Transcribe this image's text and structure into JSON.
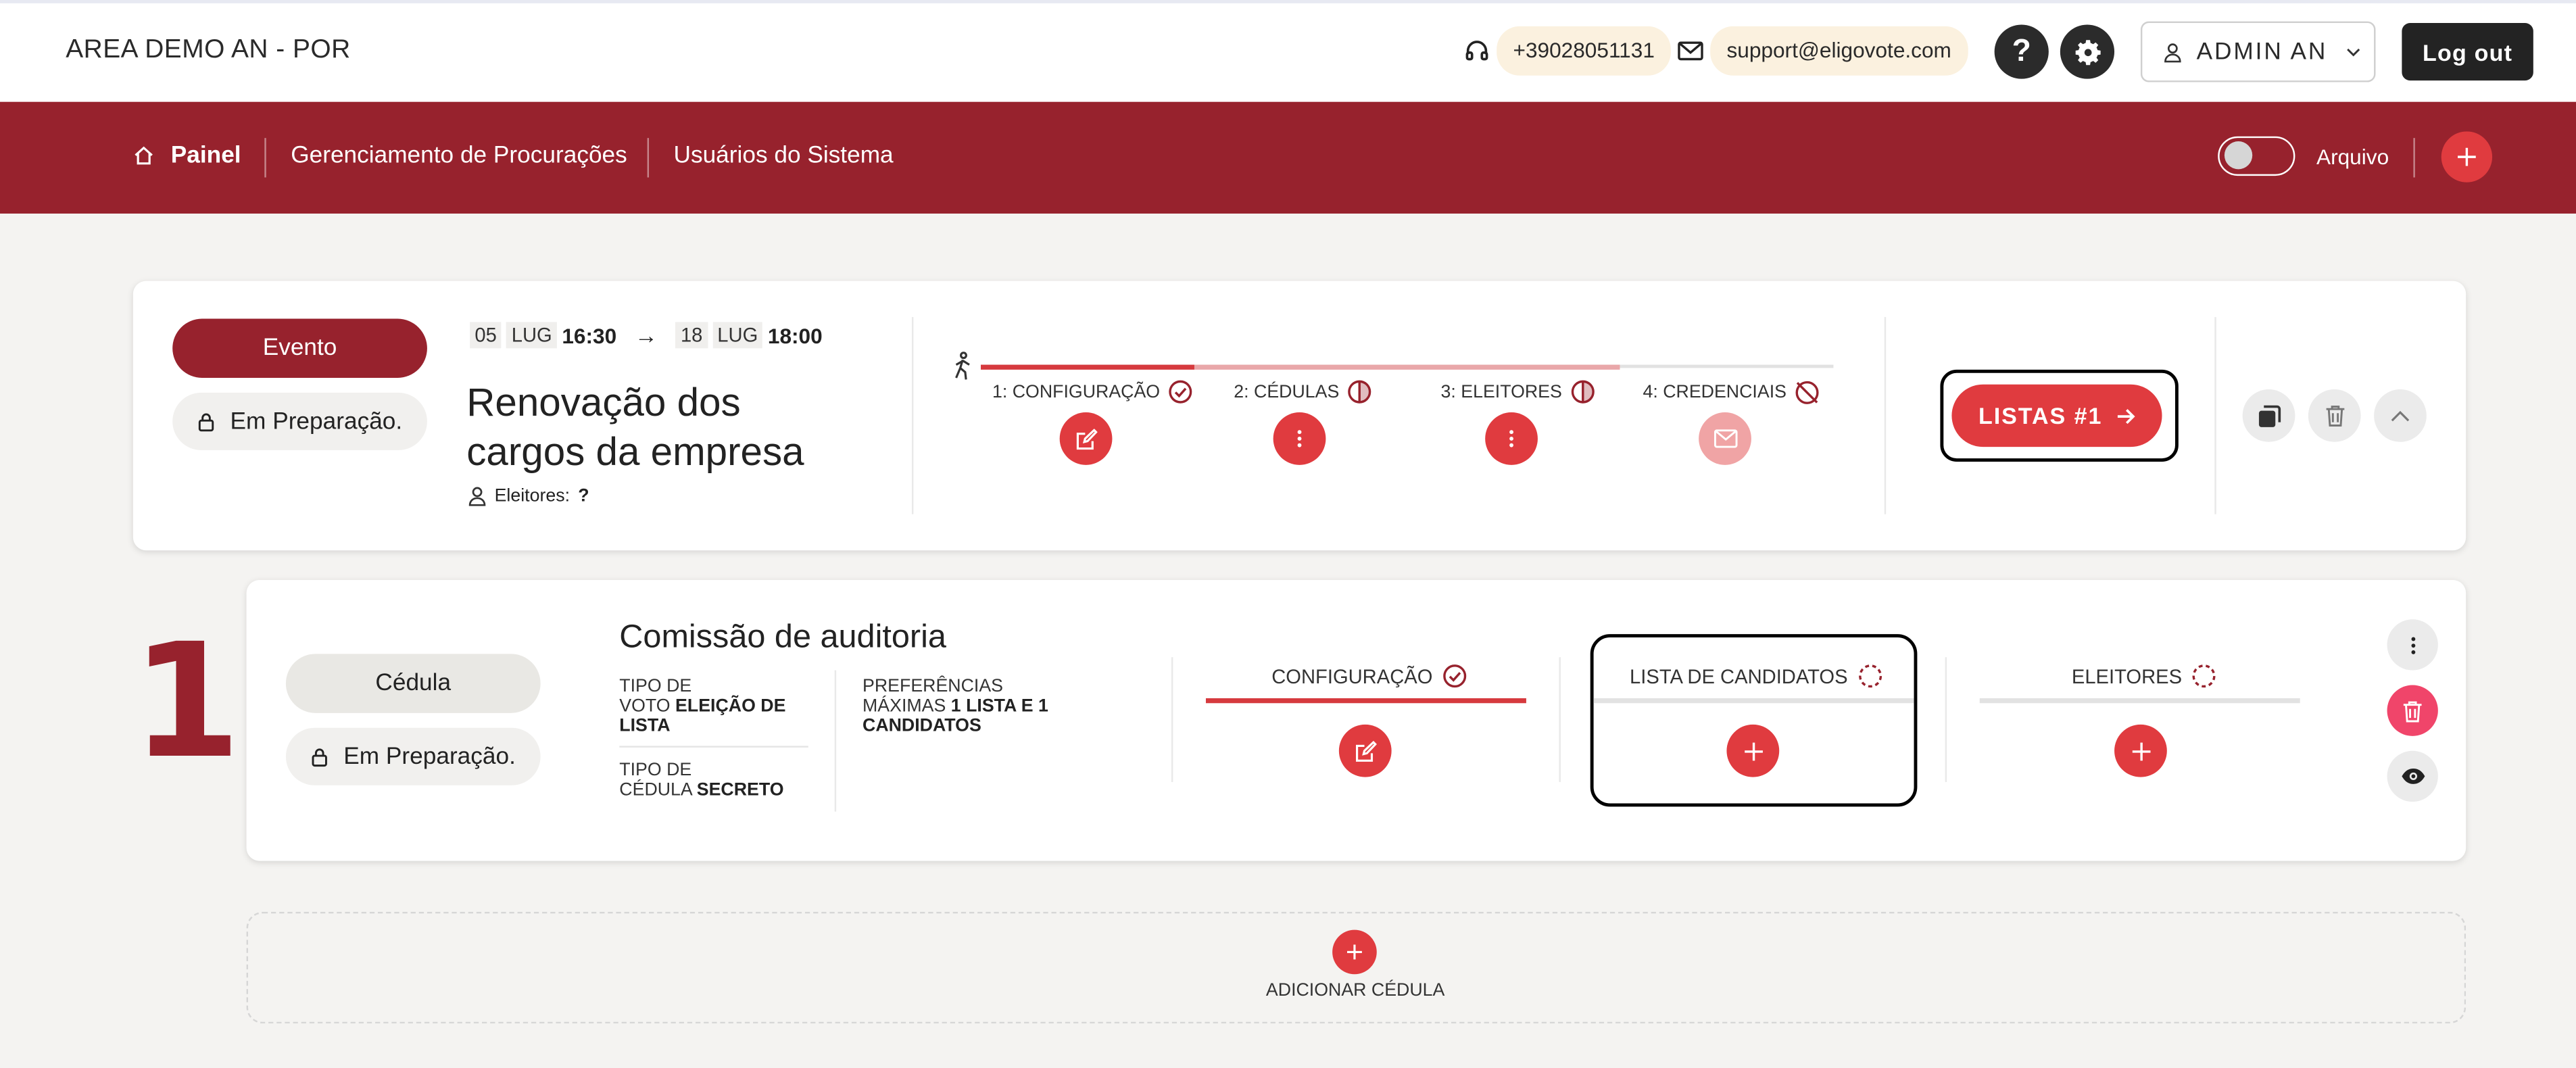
{
  "header": {
    "title": "AREA DEMO AN - POR",
    "phone": "+39028051131",
    "email": "support@eligovote.com",
    "user_label": "ADMIN AN",
    "logout_label": "Log out",
    "help_label": "?"
  },
  "nav": {
    "items": [
      {
        "label": "Painel"
      },
      {
        "label": "Gerenciamento de Procurações"
      },
      {
        "label": "Usuários do Sistema"
      }
    ],
    "archive_label": "Arquivo"
  },
  "event": {
    "type_label": "Evento",
    "status_label": "Em Preparação.",
    "start": {
      "day": "05",
      "month": "LUG",
      "time": "16:30"
    },
    "end": {
      "day": "18",
      "month": "LUG",
      "time": "18:00"
    },
    "arrow": "→",
    "title_line1": "Renovação dos",
    "title_line2": "cargos da empresa",
    "voters_label": "Eleitores:",
    "voters_value": "?",
    "steps": [
      {
        "label": "1: CONFIGURAÇÃO"
      },
      {
        "label": "2: CÉDULAS"
      },
      {
        "label": "3: ELEITORES"
      },
      {
        "label": "4: CREDENCIAIS"
      }
    ],
    "lists_button_label": "LISTAS #1"
  },
  "ballot": {
    "number": "1",
    "type_label": "Cédula",
    "status_label": "Em Preparação.",
    "title": "Comissão de auditoria",
    "vote_type_label_1": "TIPO DE",
    "vote_type_label_2": "VOTO",
    "vote_type_value_1": "ELEIÇÃO DE",
    "vote_type_value_2": "LISTA",
    "ballot_type_label_1": "TIPO DE",
    "ballot_type_label_2": "CÉDULA",
    "ballot_type_value": "SECRETO",
    "pref_label_1": "PREFERÊNCIAS",
    "pref_label_2": "MÁXIMAS",
    "pref_value_1": "1 LISTA E 1",
    "pref_value_2": "CANDIDATOS",
    "sections": [
      {
        "label": "CONFIGURAÇÃO"
      },
      {
        "label": "LISTA DE CANDIDATOS"
      },
      {
        "label": "ELEITORES"
      }
    ]
  },
  "add_ballot_label": "ADICIONAR CÉDULA",
  "colors": {
    "brand": "#97222d",
    "accent": "#e03b3f",
    "pink": "#f0456a"
  }
}
